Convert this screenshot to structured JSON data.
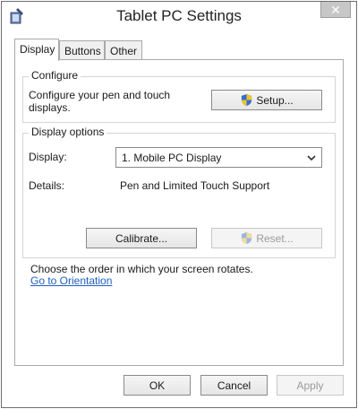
{
  "window": {
    "title": "Tablet PC Settings",
    "close_glyph": "✕",
    "app_icon": "tablet-pen-icon"
  },
  "tabs": [
    {
      "label": "Display",
      "active": true
    },
    {
      "label": "Buttons",
      "active": false
    },
    {
      "label": "Other",
      "active": false
    }
  ],
  "configure": {
    "group_label": "Configure",
    "description_line1": "Configure your pen and touch",
    "description_line2": "displays.",
    "setup_label": "Setup..."
  },
  "display_options": {
    "group_label": "Display options",
    "display_label": "Display:",
    "display_selected": "1. Mobile PC Display",
    "details_label": "Details:",
    "details_value": "Pen and Limited Touch Support",
    "calibrate_label": "Calibrate...",
    "reset_label": "Reset..."
  },
  "orientation": {
    "text": "Choose the order in which your screen rotates.",
    "link": "Go to Orientation"
  },
  "footer": {
    "ok_label": "OK",
    "cancel_label": "Cancel",
    "apply_label": "Apply"
  },
  "colors": {
    "link": "#1f5fbf",
    "shield_blue": "#2f6fd0",
    "shield_yellow": "#f2c230"
  }
}
